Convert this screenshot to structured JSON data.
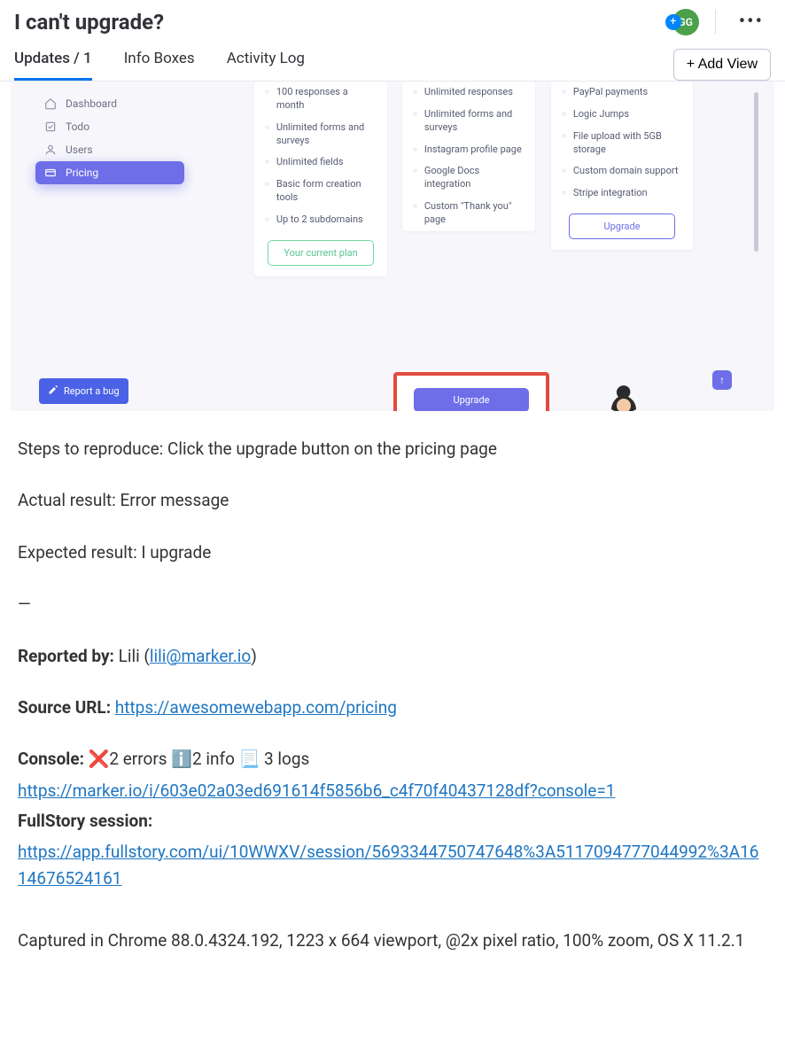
{
  "header": {
    "title": "I can't upgrade?",
    "avatar_initials": "GG",
    "add_view_label": "+ Add View"
  },
  "tabs": {
    "updates": "Updates / 1",
    "info_boxes": "Info Boxes",
    "activity_log": "Activity Log"
  },
  "screenshot": {
    "sidebar": {
      "dashboard": "Dashboard",
      "todo": "Todo",
      "users": "Users",
      "pricing": "Pricing"
    },
    "report_bug": "Report a bug",
    "plan1": {
      "f1": "100 responses a month",
      "f2": "Unlimited forms and surveys",
      "f3": "Unlimited fields",
      "f4": "Basic form creation tools",
      "f5": "Up to 2 subdomains",
      "btn": "Your current plan"
    },
    "plan2": {
      "f1": "Unlimited responses",
      "f2": "Unlimited forms and surveys",
      "f3": "Instagram profile page",
      "f4": "Google Docs integration",
      "f5": "Custom \"Thank you\" page",
      "btn": "Upgrade"
    },
    "plan3": {
      "f1": "PayPal payments",
      "f2": "Logic Jumps",
      "f3": "File upload with 5GB storage",
      "f4": "Custom domain support",
      "f5": "Stripe integration",
      "btn": "Upgrade"
    }
  },
  "content": {
    "steps_label": "Steps to reproduce: ",
    "steps_value": "Click the upgrade button on the pricing page",
    "actual_label": "Actual result: ",
    "actual_value": "Error message",
    "expected_label": "Expected result: ",
    "expected_value": "I upgrade",
    "divider": "—",
    "reported_by_label": "Reported by:",
    "reported_by_name": " Lili (",
    "reported_by_email": "lili@marker.io",
    "reported_by_close": ")",
    "source_url_label": "Source URL:",
    "source_url": "https://awesomewebapp.com/pricing",
    "console_label": "Console:",
    "console_errors_icon": "❌",
    "console_errors": "2 errors ",
    "console_info_icon": "ℹ️",
    "console_info": "2 info ",
    "console_logs_icon": "📃",
    "console_logs": "3 logs",
    "console_link": "https://marker.io/i/603e02a03ed691614f5856b6_c4f70f40437128df?console=1",
    "fullstory_label": "FullStory session:",
    "fullstory_link": "https://app.fullstory.com/ui/10WWXV/session/5693344750747648%3A5117094777044992%3A1614676524161",
    "captured": "Captured in Chrome 88.0.4324.192, 1223 x 664 viewport, @2x pixel ratio, 100% zoom, OS X 11.2.1"
  }
}
